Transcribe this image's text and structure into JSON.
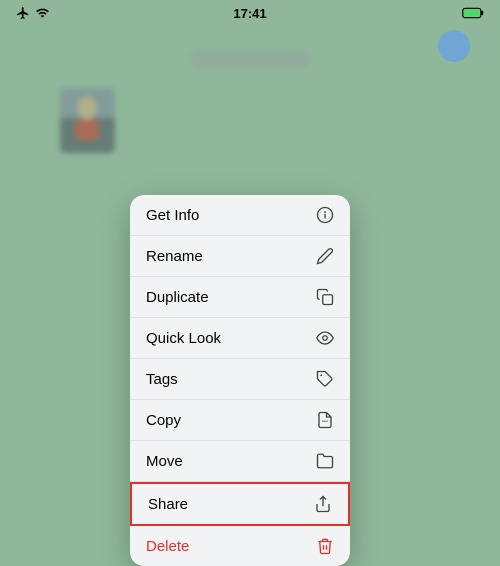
{
  "statusBar": {
    "time": "17:41",
    "icons": {
      "wifi": "wifi-icon",
      "airplane": "airplane-icon",
      "battery": "battery-icon"
    }
  },
  "contextMenu": {
    "items": [
      {
        "id": "get-info",
        "label": "Get Info",
        "icon": "info-circle"
      },
      {
        "id": "rename",
        "label": "Rename",
        "icon": "pencil"
      },
      {
        "id": "duplicate",
        "label": "Duplicate",
        "icon": "duplicate"
      },
      {
        "id": "quick-look",
        "label": "Quick Look",
        "icon": "eye"
      },
      {
        "id": "tags",
        "label": "Tags",
        "icon": "tag"
      },
      {
        "id": "copy",
        "label": "Copy",
        "icon": "copy"
      },
      {
        "id": "move",
        "label": "Move",
        "icon": "folder"
      },
      {
        "id": "share",
        "label": "Share",
        "icon": "share",
        "highlighted": true
      },
      {
        "id": "delete",
        "label": "Delete",
        "icon": "trash",
        "danger": true
      }
    ]
  }
}
